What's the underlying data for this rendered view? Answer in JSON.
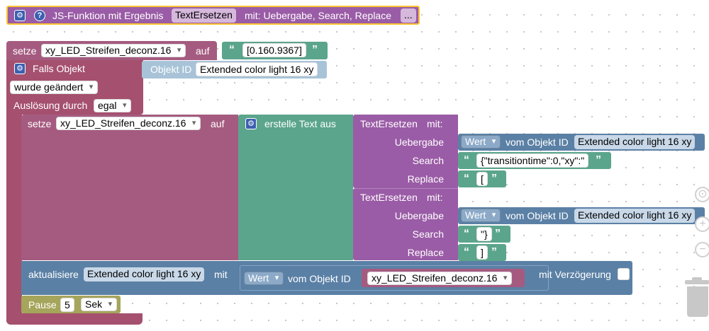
{
  "func": {
    "label": "JS-Funktion mit Ergebnis",
    "name": "TextErsetzen",
    "params": "mit: Uebergabe, Search, Replace",
    "more": "..."
  },
  "top": {
    "set": "setze",
    "var": "xy_LED_Streifen_deconz.16",
    "auf": "auf",
    "value": "[0.160.9367]",
    "trigger": "Falls Objekt",
    "obj_id_label": "Objekt ID",
    "obj_id": "Extended color light 16 xy",
    "changed": "wurde geändert",
    "triggered_by": "Auslösung durch",
    "triggered_value": "egal"
  },
  "inner": {
    "set": "setze",
    "var": "xy_LED_Streifen_deconz.16",
    "auf": "auf",
    "create_text": "erstelle Text aus",
    "calls": [
      {
        "fn": "TextErsetzen",
        "mit": "mit:",
        "param1": "Uebergabe",
        "param2": "Search",
        "param3": "Replace",
        "wert": "Wert",
        "vom_objekt": "vom Objekt ID",
        "object": "Extended color light 16 xy",
        "search": "{\"transitiontime\":0,\"xy\":\"",
        "replace": "["
      },
      {
        "fn": "TextErsetzen",
        "mit": "mit:",
        "param1": "Uebergabe",
        "param2": "Search",
        "param3": "Replace",
        "wert": "Wert",
        "vom_objekt": "vom Objekt ID",
        "object": "Extended color light 16 xy",
        "search": "\"}",
        "replace": "]"
      }
    ]
  },
  "update": {
    "label": "aktualisiere",
    "target": "Extended color light 16 xy",
    "mit": "mit",
    "wert": "Wert",
    "vom_objekt": "vom Objekt ID",
    "object": "xy_LED_Streifen_deconz.16",
    "delay": "mit Verzögerung"
  },
  "pause": {
    "label": "Pause",
    "value": "5",
    "unit": "Sek"
  },
  "icons": {
    "gear": "gear-icon",
    "help": "help-icon",
    "quote": "quote-icon",
    "zoom_in": "zoom-in-icon",
    "zoom_reset": "zoom-reset-icon",
    "zoom_out": "zoom-out-icon",
    "trash": "trash-icon"
  },
  "colors": {
    "event": "#a5506e",
    "variable": "#a55b80",
    "text": "#5ba58c",
    "procedure": "#9a5ca6",
    "object": "#5b80a5",
    "timer": "#a5a55b",
    "highlight": "#fcc432"
  }
}
